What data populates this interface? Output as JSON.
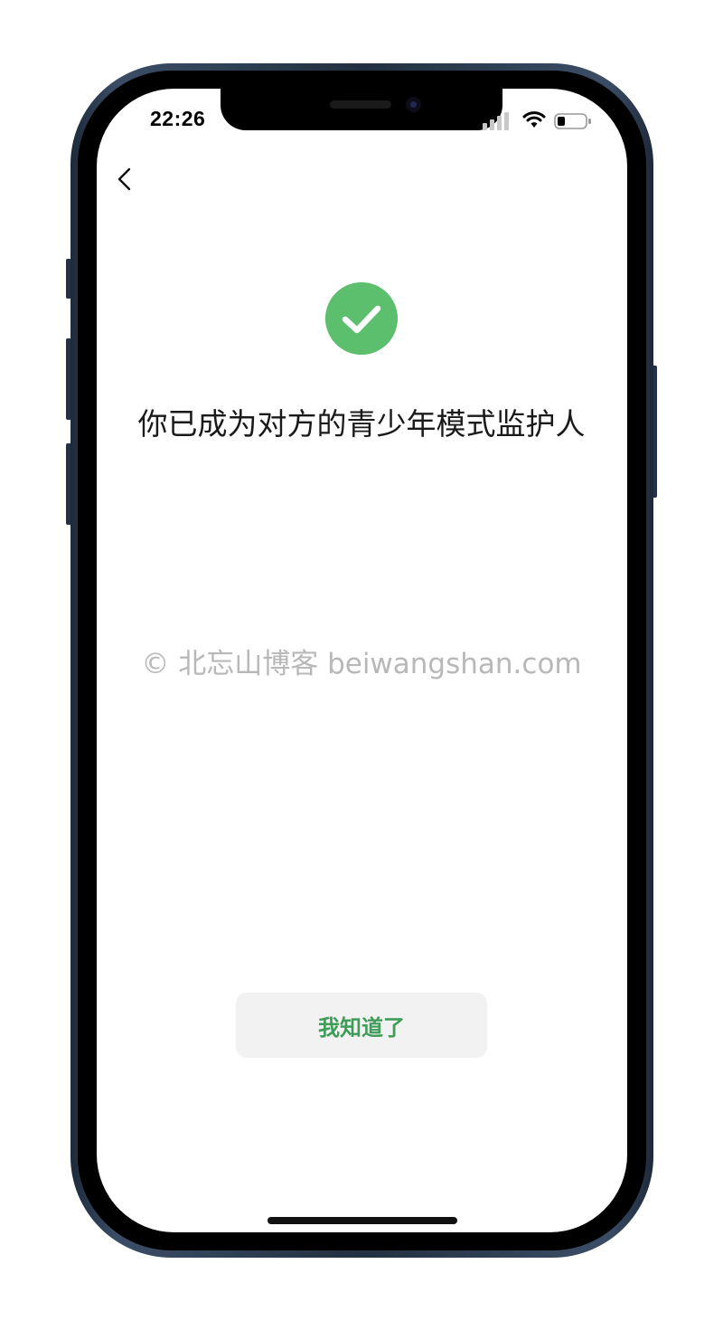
{
  "status_bar": {
    "time": "22:26",
    "signal_icon": "cellular-signal-icon",
    "wifi_icon": "wifi-icon",
    "battery_icon": "battery-low-icon"
  },
  "nav": {
    "back_icon": "chevron-left-icon"
  },
  "success": {
    "icon": "checkmark-circle-icon",
    "icon_color": "#5bbf6e",
    "message": "你已成为对方的青少年模式监护人"
  },
  "watermark": "© 北忘山博客 beiwangshan.com",
  "actions": {
    "confirm_label": "我知道了",
    "confirm_color": "#3f9d58"
  }
}
